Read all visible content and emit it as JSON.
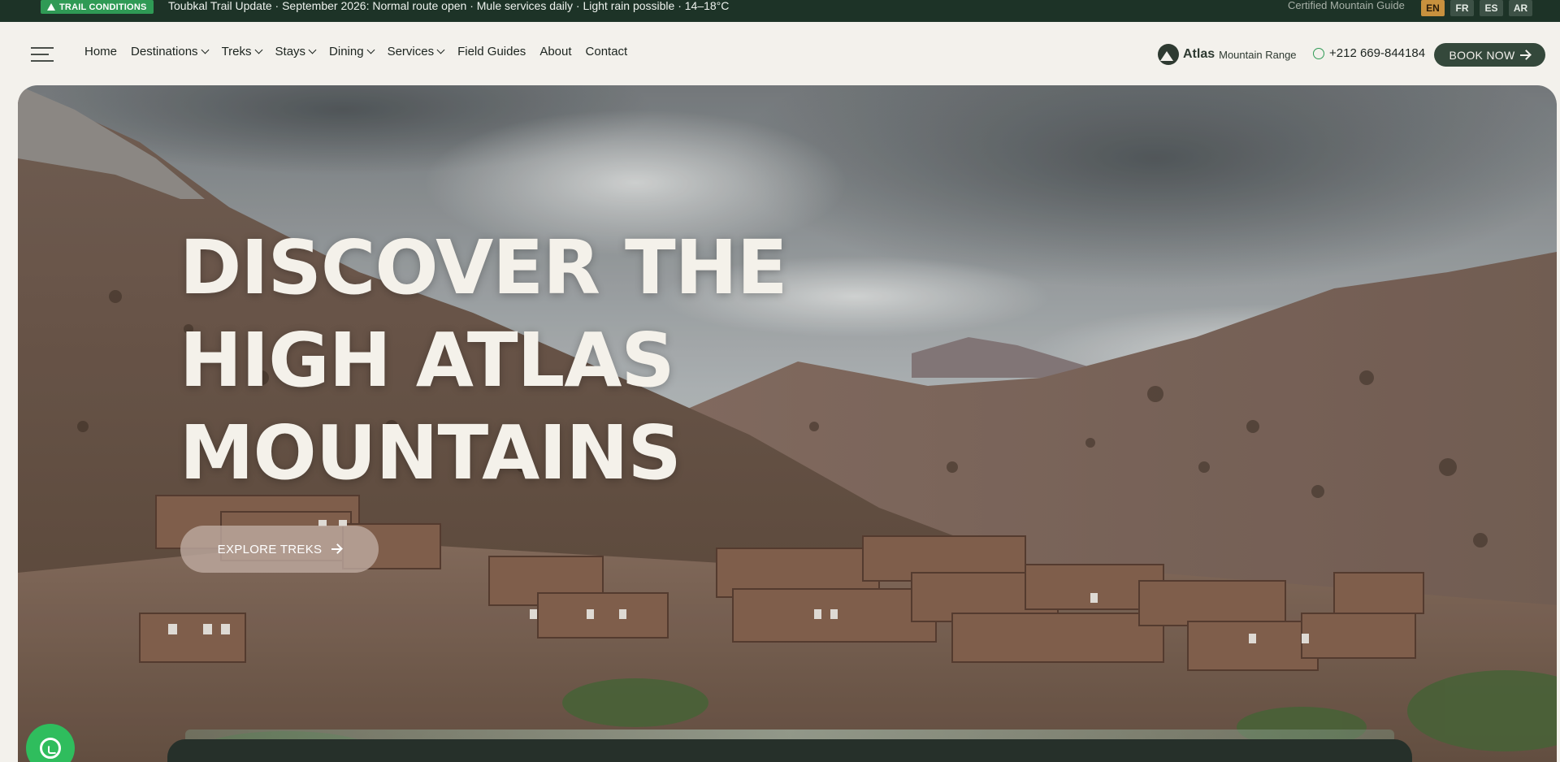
{
  "topbar": {
    "tag_label": "TRAIL CONDITIONS",
    "announcement": "Toubkal Trail Update · September 2026: Normal route open · Mule services daily · Light rain possible · 14–18°C",
    "certified": "Certified Mountain Guide",
    "languages": [
      {
        "code": "EN",
        "active": true
      },
      {
        "code": "FR",
        "active": false
      },
      {
        "code": "ES",
        "active": false
      },
      {
        "code": "AR",
        "active": false
      }
    ]
  },
  "nav": {
    "items": [
      {
        "label": "Home",
        "dropdown": false
      },
      {
        "label": "Destinations",
        "dropdown": true
      },
      {
        "label": "Treks",
        "dropdown": true
      },
      {
        "label": "Stays",
        "dropdown": true
      },
      {
        "label": "Dining",
        "dropdown": true
      },
      {
        "label": "Services",
        "dropdown": true
      },
      {
        "label": "Field Guides",
        "dropdown": false
      },
      {
        "label": "About",
        "dropdown": false
      },
      {
        "label": "Contact",
        "dropdown": false
      }
    ],
    "logo_bold": "Atlas",
    "logo_light": "Mountain Range",
    "phone": "+212 669-844184",
    "book_label": "BOOK NOW"
  },
  "hero": {
    "headline": [
      "DISCOVER THE",
      "HIGH ATLAS",
      "MOUNTAINS"
    ],
    "cta_label": "EXPLORE TREKS"
  },
  "colors": {
    "topbar_bg": "#1d3327",
    "tag_bg": "#2f9a55",
    "active_lang": "#c8913e",
    "book_button": "#34483b",
    "page_bg": "#f3f1ec",
    "whatsapp": "#2fbd5d"
  },
  "icons": {
    "menu": "hamburger-icon",
    "warning": "warning-triangle-icon",
    "whatsapp": "whatsapp-icon",
    "arrow": "arrow-right-icon",
    "chevron": "chevron-down-icon"
  }
}
